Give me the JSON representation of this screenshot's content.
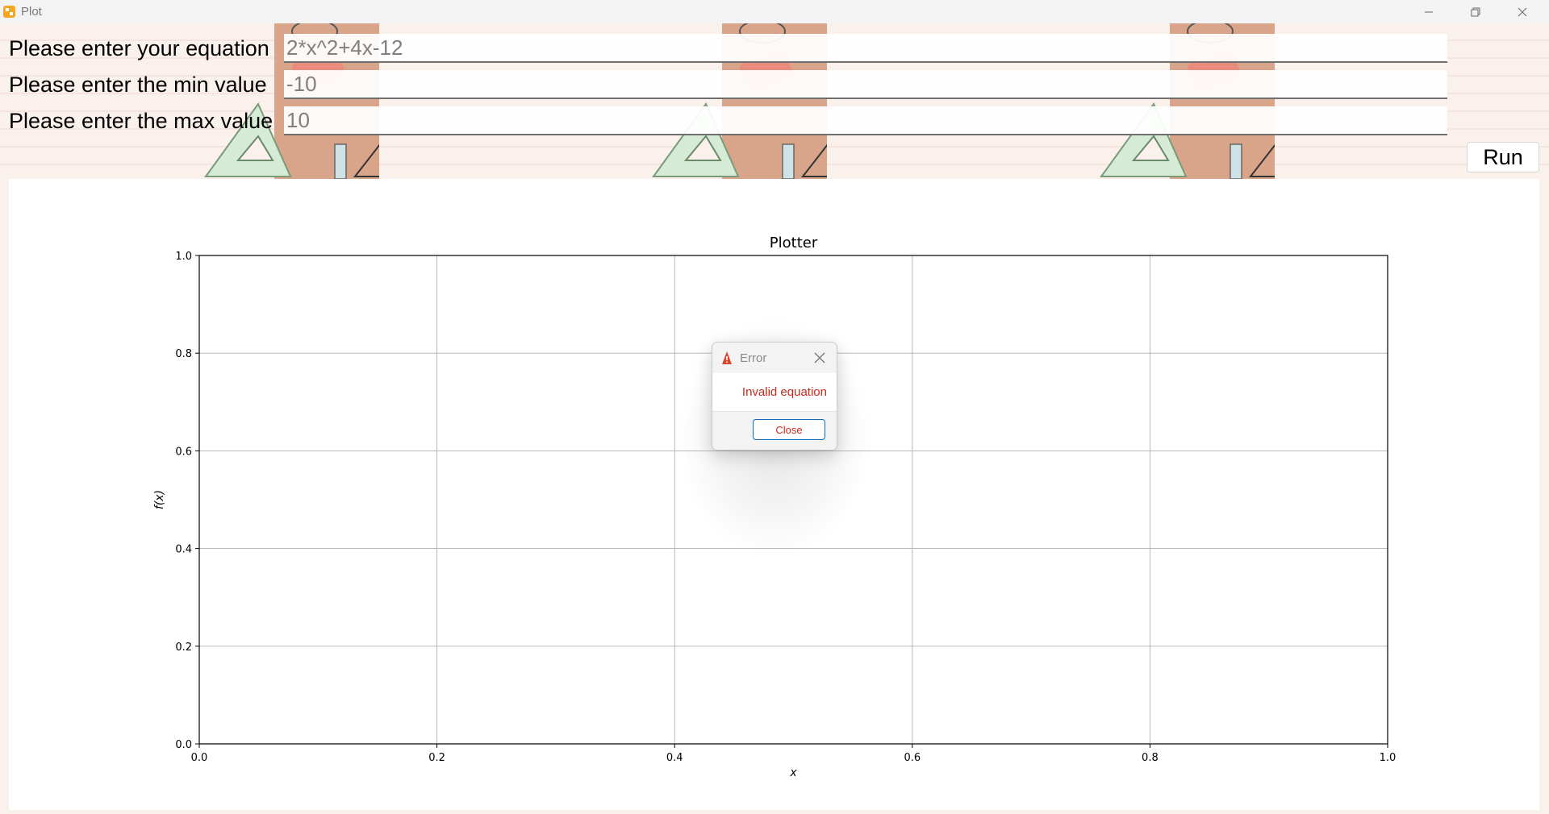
{
  "window": {
    "title": "Plot",
    "icon": "plot-app-icon",
    "controls": [
      "minimize-icon",
      "restore-icon",
      "close-icon"
    ]
  },
  "form": {
    "equation_label": "Please enter your equation",
    "equation_value": "2*x^2+4x-12",
    "min_label": "Please enter the min value",
    "min_value": "-10",
    "max_label": "Please enter the max value",
    "max_value": "10",
    "run_label": "Run"
  },
  "chart_data": {
    "type": "line",
    "title": "Plotter",
    "xlabel": "x",
    "ylabel": "f(x)",
    "xlim": [
      0.0,
      1.0
    ],
    "ylim": [
      0.0,
      1.0
    ],
    "xticks": [
      "0.0",
      "0.2",
      "0.4",
      "0.6",
      "0.8",
      "1.0"
    ],
    "yticks": [
      "0.0",
      "0.2",
      "0.4",
      "0.6",
      "0.8",
      "1.0"
    ],
    "grid": true,
    "series": []
  },
  "dialog": {
    "title": "Error",
    "icon": "warning-icon",
    "message": "Invalid equation",
    "button": "Close"
  },
  "colors": {
    "background": "#fbf1ec",
    "error_text": "#c42b1c",
    "button_border": "#0f6cbd"
  }
}
